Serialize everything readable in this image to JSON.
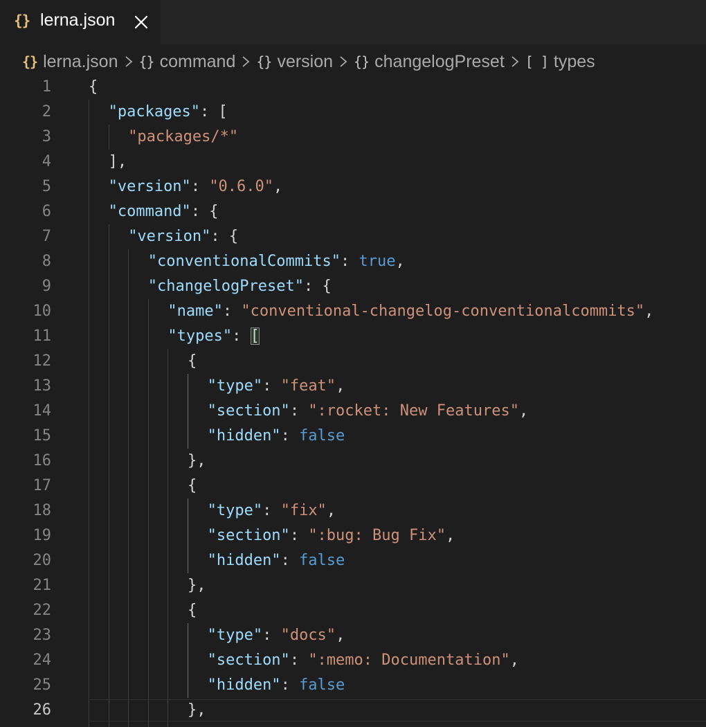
{
  "tab": {
    "icon": "{}",
    "filename": "lerna.json",
    "close_icon": "close-icon"
  },
  "breadcrumb": [
    {
      "icon": "{}",
      "icon_name": "json-file-icon",
      "label": "lerna.json"
    },
    {
      "icon": "{}",
      "icon_name": "object-icon",
      "label": "command"
    },
    {
      "icon": "{}",
      "icon_name": "object-icon",
      "label": "version"
    },
    {
      "icon": "{}",
      "icon_name": "object-icon",
      "label": "changelogPreset"
    },
    {
      "icon": "[ ]",
      "icon_name": "array-icon",
      "label": "types"
    }
  ],
  "editor": {
    "current_line": 26,
    "lines": [
      {
        "n": "1",
        "indent": 0,
        "tokens": [
          {
            "t": "p",
            "v": "{"
          }
        ]
      },
      {
        "n": "2",
        "indent": 1,
        "tokens": [
          {
            "t": "k",
            "v": "\"packages\""
          },
          {
            "t": "p",
            "v": ": ["
          }
        ]
      },
      {
        "n": "3",
        "indent": 2,
        "tokens": [
          {
            "t": "s",
            "v": "\"packages/*\""
          }
        ]
      },
      {
        "n": "4",
        "indent": 1,
        "tokens": [
          {
            "t": "p",
            "v": "],"
          }
        ]
      },
      {
        "n": "5",
        "indent": 1,
        "tokens": [
          {
            "t": "k",
            "v": "\"version\""
          },
          {
            "t": "p",
            "v": ": "
          },
          {
            "t": "s",
            "v": "\"0.6.0\""
          },
          {
            "t": "p",
            "v": ","
          }
        ]
      },
      {
        "n": "6",
        "indent": 1,
        "tokens": [
          {
            "t": "k",
            "v": "\"command\""
          },
          {
            "t": "p",
            "v": ": {"
          }
        ]
      },
      {
        "n": "7",
        "indent": 2,
        "tokens": [
          {
            "t": "k",
            "v": "\"version\""
          },
          {
            "t": "p",
            "v": ": {"
          }
        ]
      },
      {
        "n": "8",
        "indent": 3,
        "tokens": [
          {
            "t": "k",
            "v": "\"conventionalCommits\""
          },
          {
            "t": "p",
            "v": ": "
          },
          {
            "t": "b",
            "v": "true"
          },
          {
            "t": "p",
            "v": ","
          }
        ]
      },
      {
        "n": "9",
        "indent": 3,
        "tokens": [
          {
            "t": "k",
            "v": "\"changelogPreset\""
          },
          {
            "t": "p",
            "v": ": {"
          }
        ]
      },
      {
        "n": "10",
        "indent": 4,
        "tokens": [
          {
            "t": "k",
            "v": "\"name\""
          },
          {
            "t": "p",
            "v": ": "
          },
          {
            "t": "s",
            "v": "\"conventional-changelog-conventionalcommits\""
          },
          {
            "t": "p",
            "v": ","
          }
        ]
      },
      {
        "n": "11",
        "indent": 4,
        "tokens": [
          {
            "t": "k",
            "v": "\"types\""
          },
          {
            "t": "p",
            "v": ": "
          },
          {
            "t": "m",
            "v": "["
          }
        ]
      },
      {
        "n": "12",
        "indent": 5,
        "tokens": [
          {
            "t": "p",
            "v": "{"
          }
        ]
      },
      {
        "n": "13",
        "indent": 6,
        "tokens": [
          {
            "t": "k",
            "v": "\"type\""
          },
          {
            "t": "p",
            "v": ": "
          },
          {
            "t": "s",
            "v": "\"feat\""
          },
          {
            "t": "p",
            "v": ","
          }
        ]
      },
      {
        "n": "14",
        "indent": 6,
        "tokens": [
          {
            "t": "k",
            "v": "\"section\""
          },
          {
            "t": "p",
            "v": ": "
          },
          {
            "t": "s",
            "v": "\":rocket: New Features\""
          },
          {
            "t": "p",
            "v": ","
          }
        ]
      },
      {
        "n": "15",
        "indent": 6,
        "tokens": [
          {
            "t": "k",
            "v": "\"hidden\""
          },
          {
            "t": "p",
            "v": ": "
          },
          {
            "t": "b",
            "v": "false"
          }
        ]
      },
      {
        "n": "16",
        "indent": 5,
        "tokens": [
          {
            "t": "p",
            "v": "},"
          }
        ]
      },
      {
        "n": "17",
        "indent": 5,
        "tokens": [
          {
            "t": "p",
            "v": "{"
          }
        ]
      },
      {
        "n": "18",
        "indent": 6,
        "tokens": [
          {
            "t": "k",
            "v": "\"type\""
          },
          {
            "t": "p",
            "v": ": "
          },
          {
            "t": "s",
            "v": "\"fix\""
          },
          {
            "t": "p",
            "v": ","
          }
        ]
      },
      {
        "n": "19",
        "indent": 6,
        "tokens": [
          {
            "t": "k",
            "v": "\"section\""
          },
          {
            "t": "p",
            "v": ": "
          },
          {
            "t": "s",
            "v": "\":bug: Bug Fix\""
          },
          {
            "t": "p",
            "v": ","
          }
        ]
      },
      {
        "n": "20",
        "indent": 6,
        "tokens": [
          {
            "t": "k",
            "v": "\"hidden\""
          },
          {
            "t": "p",
            "v": ": "
          },
          {
            "t": "b",
            "v": "false"
          }
        ]
      },
      {
        "n": "21",
        "indent": 5,
        "tokens": [
          {
            "t": "p",
            "v": "},"
          }
        ]
      },
      {
        "n": "22",
        "indent": 5,
        "tokens": [
          {
            "t": "p",
            "v": "{"
          }
        ]
      },
      {
        "n": "23",
        "indent": 6,
        "tokens": [
          {
            "t": "k",
            "v": "\"type\""
          },
          {
            "t": "p",
            "v": ": "
          },
          {
            "t": "s",
            "v": "\"docs\""
          },
          {
            "t": "p",
            "v": ","
          }
        ]
      },
      {
        "n": "24",
        "indent": 6,
        "tokens": [
          {
            "t": "k",
            "v": "\"section\""
          },
          {
            "t": "p",
            "v": ": "
          },
          {
            "t": "s",
            "v": "\":memo: Documentation\""
          },
          {
            "t": "p",
            "v": ","
          }
        ]
      },
      {
        "n": "25",
        "indent": 6,
        "tokens": [
          {
            "t": "k",
            "v": "\"hidden\""
          },
          {
            "t": "p",
            "v": ": "
          },
          {
            "t": "b",
            "v": "false"
          }
        ]
      },
      {
        "n": "26",
        "indent": 5,
        "tokens": [
          {
            "t": "p",
            "v": "},"
          }
        ]
      }
    ]
  },
  "colors": {
    "background": "#1e1e1e",
    "key": "#9cdcfe",
    "string": "#ce9178",
    "boolean": "#569cd6",
    "punctuation": "#d4d4d4",
    "line_number": "#858585",
    "json_icon": "#e5c07b"
  }
}
